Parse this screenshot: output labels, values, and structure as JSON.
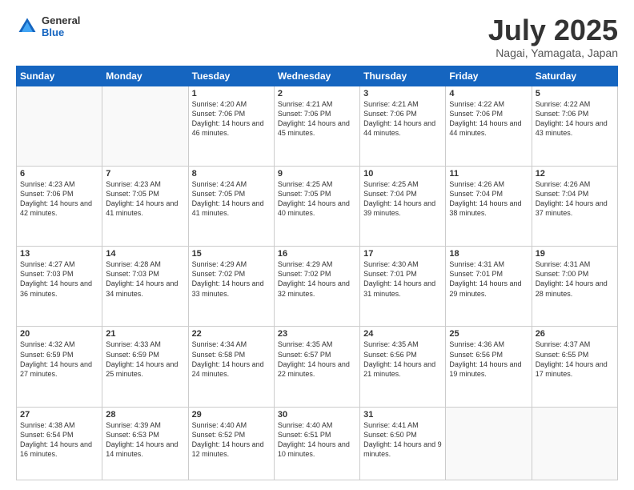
{
  "logo": {
    "general": "General",
    "blue": "Blue"
  },
  "header": {
    "month": "July 2025",
    "location": "Nagai, Yamagata, Japan"
  },
  "days": [
    "Sunday",
    "Monday",
    "Tuesday",
    "Wednesday",
    "Thursday",
    "Friday",
    "Saturday"
  ],
  "weeks": [
    [
      {
        "day": "",
        "content": ""
      },
      {
        "day": "",
        "content": ""
      },
      {
        "day": "1",
        "content": "Sunrise: 4:20 AM\nSunset: 7:06 PM\nDaylight: 14 hours and 46 minutes."
      },
      {
        "day": "2",
        "content": "Sunrise: 4:21 AM\nSunset: 7:06 PM\nDaylight: 14 hours and 45 minutes."
      },
      {
        "day": "3",
        "content": "Sunrise: 4:21 AM\nSunset: 7:06 PM\nDaylight: 14 hours and 44 minutes."
      },
      {
        "day": "4",
        "content": "Sunrise: 4:22 AM\nSunset: 7:06 PM\nDaylight: 14 hours and 44 minutes."
      },
      {
        "day": "5",
        "content": "Sunrise: 4:22 AM\nSunset: 7:06 PM\nDaylight: 14 hours and 43 minutes."
      }
    ],
    [
      {
        "day": "6",
        "content": "Sunrise: 4:23 AM\nSunset: 7:06 PM\nDaylight: 14 hours and 42 minutes."
      },
      {
        "day": "7",
        "content": "Sunrise: 4:23 AM\nSunset: 7:05 PM\nDaylight: 14 hours and 41 minutes."
      },
      {
        "day": "8",
        "content": "Sunrise: 4:24 AM\nSunset: 7:05 PM\nDaylight: 14 hours and 41 minutes."
      },
      {
        "day": "9",
        "content": "Sunrise: 4:25 AM\nSunset: 7:05 PM\nDaylight: 14 hours and 40 minutes."
      },
      {
        "day": "10",
        "content": "Sunrise: 4:25 AM\nSunset: 7:04 PM\nDaylight: 14 hours and 39 minutes."
      },
      {
        "day": "11",
        "content": "Sunrise: 4:26 AM\nSunset: 7:04 PM\nDaylight: 14 hours and 38 minutes."
      },
      {
        "day": "12",
        "content": "Sunrise: 4:26 AM\nSunset: 7:04 PM\nDaylight: 14 hours and 37 minutes."
      }
    ],
    [
      {
        "day": "13",
        "content": "Sunrise: 4:27 AM\nSunset: 7:03 PM\nDaylight: 14 hours and 36 minutes."
      },
      {
        "day": "14",
        "content": "Sunrise: 4:28 AM\nSunset: 7:03 PM\nDaylight: 14 hours and 34 minutes."
      },
      {
        "day": "15",
        "content": "Sunrise: 4:29 AM\nSunset: 7:02 PM\nDaylight: 14 hours and 33 minutes."
      },
      {
        "day": "16",
        "content": "Sunrise: 4:29 AM\nSunset: 7:02 PM\nDaylight: 14 hours and 32 minutes."
      },
      {
        "day": "17",
        "content": "Sunrise: 4:30 AM\nSunset: 7:01 PM\nDaylight: 14 hours and 31 minutes."
      },
      {
        "day": "18",
        "content": "Sunrise: 4:31 AM\nSunset: 7:01 PM\nDaylight: 14 hours and 29 minutes."
      },
      {
        "day": "19",
        "content": "Sunrise: 4:31 AM\nSunset: 7:00 PM\nDaylight: 14 hours and 28 minutes."
      }
    ],
    [
      {
        "day": "20",
        "content": "Sunrise: 4:32 AM\nSunset: 6:59 PM\nDaylight: 14 hours and 27 minutes."
      },
      {
        "day": "21",
        "content": "Sunrise: 4:33 AM\nSunset: 6:59 PM\nDaylight: 14 hours and 25 minutes."
      },
      {
        "day": "22",
        "content": "Sunrise: 4:34 AM\nSunset: 6:58 PM\nDaylight: 14 hours and 24 minutes."
      },
      {
        "day": "23",
        "content": "Sunrise: 4:35 AM\nSunset: 6:57 PM\nDaylight: 14 hours and 22 minutes."
      },
      {
        "day": "24",
        "content": "Sunrise: 4:35 AM\nSunset: 6:56 PM\nDaylight: 14 hours and 21 minutes."
      },
      {
        "day": "25",
        "content": "Sunrise: 4:36 AM\nSunset: 6:56 PM\nDaylight: 14 hours and 19 minutes."
      },
      {
        "day": "26",
        "content": "Sunrise: 4:37 AM\nSunset: 6:55 PM\nDaylight: 14 hours and 17 minutes."
      }
    ],
    [
      {
        "day": "27",
        "content": "Sunrise: 4:38 AM\nSunset: 6:54 PM\nDaylight: 14 hours and 16 minutes."
      },
      {
        "day": "28",
        "content": "Sunrise: 4:39 AM\nSunset: 6:53 PM\nDaylight: 14 hours and 14 minutes."
      },
      {
        "day": "29",
        "content": "Sunrise: 4:40 AM\nSunset: 6:52 PM\nDaylight: 14 hours and 12 minutes."
      },
      {
        "day": "30",
        "content": "Sunrise: 4:40 AM\nSunset: 6:51 PM\nDaylight: 14 hours and 10 minutes."
      },
      {
        "day": "31",
        "content": "Sunrise: 4:41 AM\nSunset: 6:50 PM\nDaylight: 14 hours and 9 minutes."
      },
      {
        "day": "",
        "content": ""
      },
      {
        "day": "",
        "content": ""
      }
    ]
  ]
}
